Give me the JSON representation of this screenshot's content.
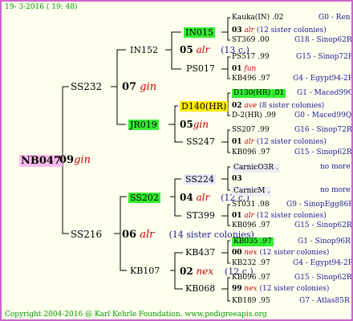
{
  "header_date": "19-  3-2016 ( 19: 48)",
  "root": {
    "name": "NB047",
    "year": "09",
    "note": "gin"
  },
  "gen1": [
    {
      "name": "SS232"
    },
    {
      "name": "SS216"
    }
  ],
  "gen2": [
    {
      "year": "07",
      "note": "gin"
    },
    {
      "year": "06",
      "note": "alr",
      "sisters": "(14 sister colonies)"
    }
  ],
  "gen2names": [
    "IN152",
    "JR019",
    "SS202",
    "KB107"
  ],
  "gen3": [
    {
      "year": "05",
      "note": "alr",
      "extra": "(13 c.)"
    },
    {
      "year": "05",
      "note": "gin"
    },
    {
      "year": "04",
      "note": "alr",
      "extra": "(12 c.)"
    },
    {
      "year": "02",
      "note": "nex",
      "extra": "(12 c.)"
    }
  ],
  "gen3names": [
    "IN015",
    "PS017",
    "D140(HR)",
    "SS247",
    "SS224",
    "ST399",
    "KB437",
    "KB068"
  ],
  "g4": [
    {
      "name": "Kauka(IN)",
      "year": ".02",
      "origin": "G0 - Ren"
    },
    {
      "year": "03",
      "note": "alr",
      "sisters": "(12 sister colonies)"
    },
    {
      "name": "ST369",
      "year": ".00",
      "origin": "G18 - Sinop62R"
    },
    {
      "name": "PS517",
      "year": ".99",
      "origin": "G15 - Sinop72R"
    },
    {
      "year": "01",
      "note": "fun"
    },
    {
      "name": "KB496",
      "year": ".97",
      "origin": "G4 - Egypt94-2R"
    },
    {
      "name": "D130(HR)",
      "year": ".01",
      "origin": "G1 - Maced99Q"
    },
    {
      "year": "02",
      "note": "ave",
      "sisters": "(8 sister colonies)"
    },
    {
      "name": "D-2(HR)",
      "year": ".99",
      "origin": "G0 - Maced99Q"
    },
    {
      "name": "SS207",
      "year": ".99",
      "origin": "G16 - Sinop72R"
    },
    {
      "year": "01",
      "note": "alr",
      "sisters": "(12 sister colonies)"
    },
    {
      "name": "KB096",
      "year": ".97",
      "origin": "G15 - Sinop62R"
    },
    {
      "name": "CarnicO3R",
      "year": ".",
      "origin": "no more"
    },
    {
      "year": "03"
    },
    {
      "name": "CarnicM",
      "year": ".",
      "origin": "no more"
    },
    {
      "name": "ST031",
      "year": ".98",
      "origin": "G9 - SinopEgg86R"
    },
    {
      "year": "01",
      "note": "alr",
      "sisters": "(12 sister colonies)"
    },
    {
      "name": "KB096",
      "year": ".97",
      "origin": "G15 - Sinop62R"
    },
    {
      "name": "KB035",
      "year": ".97",
      "origin": "G1 - Sinop96R"
    },
    {
      "year": "00",
      "note": "nex",
      "sisters": "(12 sister colonies)"
    },
    {
      "name": "KB232",
      "year": ".97",
      "origin": "G4 - Egypt94-2R"
    },
    {
      "name": "KB096",
      "year": ".97",
      "origin": "G15 - Sinop62R"
    },
    {
      "year": "99",
      "note": "nex",
      "sisters": "(12 sister colonies)"
    },
    {
      "name": "KB189",
      "year": ".95",
      "origin": "G7 - Atlas85R"
    }
  ],
  "footer": "Copyright 2004-2016 @ Karl Kehrle Foundation.    www.pedigreeapis.org"
}
